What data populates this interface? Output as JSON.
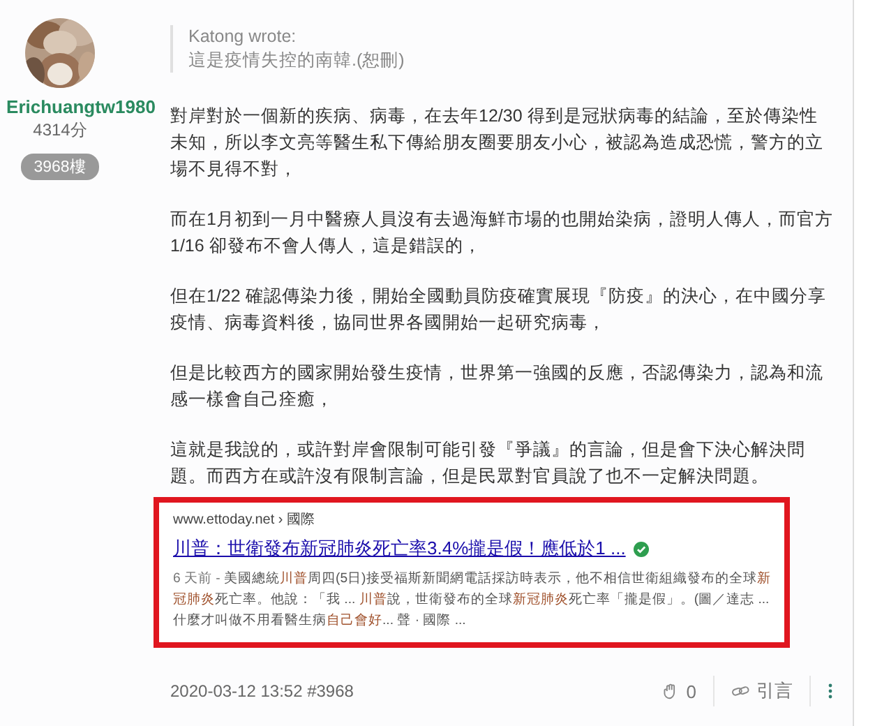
{
  "author": {
    "name": "Erichuangtw1980",
    "points": "4314分",
    "floor_badge": "3968樓"
  },
  "quote": {
    "author_line": "Katong wrote:",
    "text": "這是疫情失控的南韓.(恕刪)"
  },
  "paragraphs": [
    "對岸對於一個新的疾病、病毒，在去年12/30 得到是冠狀病毒的結論，至於傳染性未知，所以李文亮等醫生私下傳給朋友圈要朋友小心，被認為造成恐慌，警方的立場不見得不對，",
    "而在1月初到一月中醫療人員沒有去過海鮮市場的也開始染病，證明人傳人，而官方1/16 卻發布不會人傳人，這是錯誤的，",
    "但在1/22 確認傳染力後，開始全國動員防疫確實展現『防疫』的決心，在中國分享疫情、病毒資料後，協同世界各國開始一起研究病毒，",
    "但是比較西方的國家開始發生疫情，世界第一強國的反應，否認傳染力，認為和流感一樣會自己痊癒，",
    "這就是我說的，或許對岸會限制可能引發『爭議』的言論，但是會下決心解決問題。而西方在或許沒有限制言論，但是民眾對官員說了也不一定解決問題。"
  ],
  "search_result": {
    "url": "www.ettoday.net › 國際",
    "title": "川普：世衛發布新冠肺炎死亡率3.4%攏是假！應低於1 ...",
    "verified": true,
    "snippet": [
      {
        "text": "6 天前 - ",
        "kind": "date"
      },
      {
        "text": "美國總統",
        "kind": "plain"
      },
      {
        "text": "川普",
        "kind": "highlight"
      },
      {
        "text": "周四(5日)接受福斯新聞網電話採訪時表示，他不相信世衛組織發布的全球",
        "kind": "plain"
      },
      {
        "text": "新冠肺炎",
        "kind": "highlight"
      },
      {
        "text": "死亡率。他說：「我 ... ",
        "kind": "plain"
      },
      {
        "text": "川普",
        "kind": "highlight"
      },
      {
        "text": "說，世衛發布的全球",
        "kind": "plain"
      },
      {
        "text": "新冠肺炎",
        "kind": "highlight"
      },
      {
        "text": "死亡率「攏是假」。(圖／達志 ... 什麼才叫做不用看醫生病",
        "kind": "plain"
      },
      {
        "text": "自己會好",
        "kind": "highlight"
      },
      {
        "text": "... 聲 · 國際 ...",
        "kind": "plain"
      }
    ]
  },
  "footer": {
    "timestamp": "2020-03-12 13:52 #3968",
    "likes": "0",
    "quote_button": "引言"
  }
}
